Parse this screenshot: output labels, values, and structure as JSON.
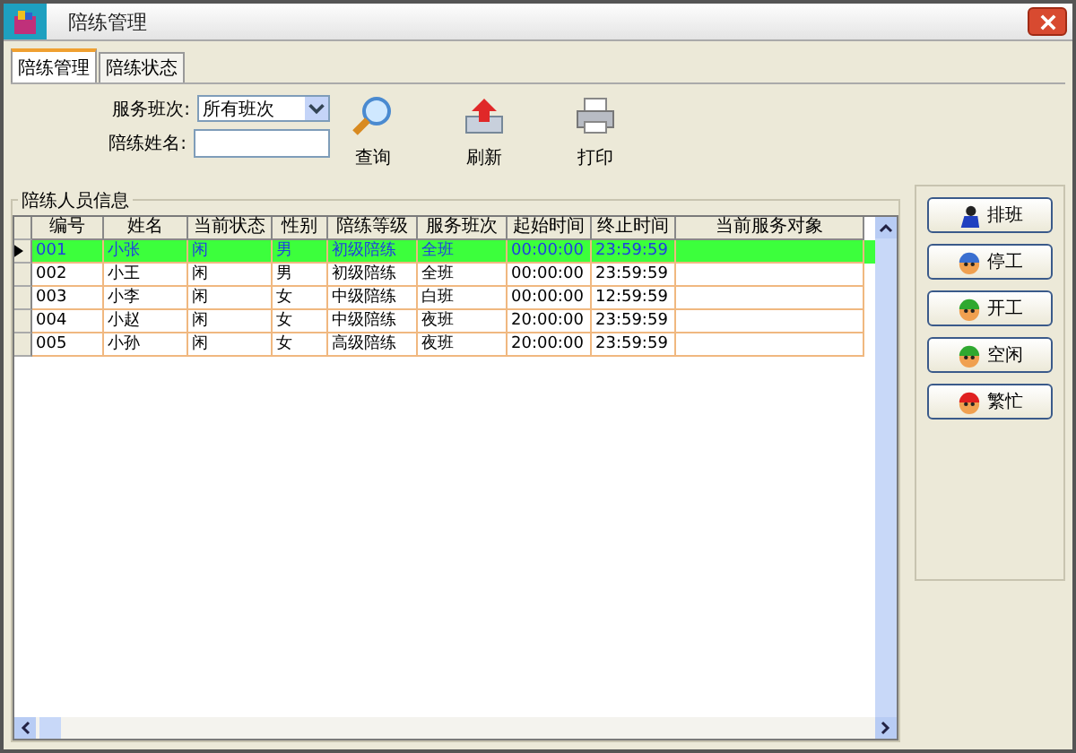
{
  "window": {
    "title": "陪练管理"
  },
  "tabs": [
    {
      "label": "陪练管理",
      "selected": true
    },
    {
      "label": "陪练状态",
      "selected": false
    }
  ],
  "form": {
    "shift_label": "服务班次:",
    "shift_value": "所有班次",
    "name_label": "陪练姓名:"
  },
  "toolbar": [
    {
      "label": "查询",
      "kind": "search"
    },
    {
      "label": "刷新",
      "kind": "refresh"
    },
    {
      "label": "打印",
      "kind": "print"
    }
  ],
  "group_title": "陪练人员信息",
  "table": {
    "columns": [
      "编号",
      "姓名",
      "当前状态",
      "性别",
      "陪练等级",
      "服务班次",
      "起始时间",
      "终止时间",
      "当前服务对象"
    ],
    "rows": [
      {
        "selected": true,
        "cells": [
          "001",
          "小张",
          "闲",
          "男",
          "初级陪练",
          "全班",
          "00:00:00",
          "23:59:59"
        ]
      },
      {
        "selected": false,
        "cells": [
          "002",
          "小王",
          "闲",
          "男",
          "初级陪练",
          "全班",
          "00:00:00",
          "23:59:59"
        ]
      },
      {
        "selected": false,
        "cells": [
          "003",
          "小李",
          "闲",
          "女",
          "中级陪练",
          "白班",
          "00:00:00",
          "12:59:59"
        ]
      },
      {
        "selected": false,
        "cells": [
          "004",
          "小赵",
          "闲",
          "女",
          "中级陪练",
          "夜班",
          "20:00:00",
          "23:59:59"
        ]
      },
      {
        "selected": false,
        "cells": [
          "005",
          "小孙",
          "闲",
          "女",
          "高级陪练",
          "夜班",
          "20:00:00",
          "23:59:59"
        ]
      }
    ]
  },
  "actions": [
    {
      "label": "排班",
      "kind": "person"
    },
    {
      "label": "停工",
      "kind": "face",
      "color": "#3a6fd0"
    },
    {
      "label": "开工",
      "kind": "face",
      "color": "#2fa82f"
    },
    {
      "label": "空闲",
      "kind": "face",
      "color": "#2fa82f"
    },
    {
      "label": "繁忙",
      "kind": "face",
      "color": "#e02020"
    }
  ]
}
